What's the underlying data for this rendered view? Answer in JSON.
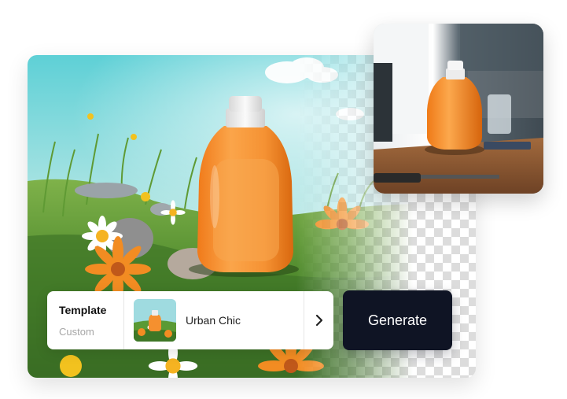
{
  "template_selector": {
    "title": "Template",
    "subtitle": "Custom",
    "selected_option": "Urban Chic"
  },
  "actions": {
    "generate_label": "Generate"
  },
  "icons": {
    "next": "chevron-right-icon"
  },
  "colors": {
    "generate_button": "#0f1424",
    "bottle_orange": "#f5902f",
    "cap": "#eeeeee"
  }
}
